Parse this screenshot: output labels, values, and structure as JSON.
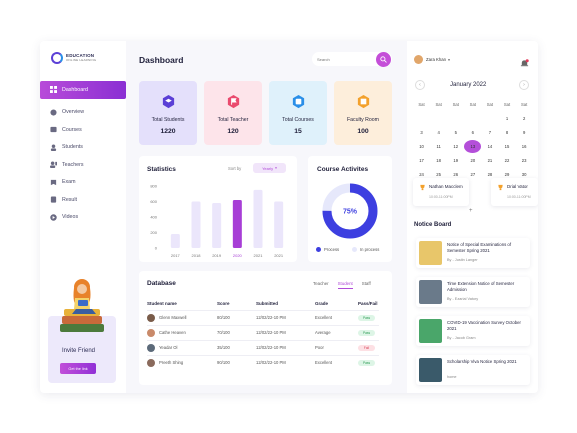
{
  "brand": {
    "name": "EDUCATION",
    "tagline": "ONLINE LEARNING"
  },
  "sidebar": {
    "items": [
      {
        "label": "Dashboard",
        "icon": "grid-icon"
      },
      {
        "label": "Overview",
        "icon": "pie-icon"
      },
      {
        "label": "Courses",
        "icon": "book-icon"
      },
      {
        "label": "Students",
        "icon": "student-icon"
      },
      {
        "label": "Teachers",
        "icon": "teacher-icon"
      },
      {
        "label": "Exam",
        "icon": "exam-icon"
      },
      {
        "label": "Result",
        "icon": "result-icon"
      },
      {
        "label": "Videos",
        "icon": "play-icon"
      }
    ],
    "invite": {
      "title": "Invite Friend",
      "button": "Get the link"
    }
  },
  "header": {
    "title": "Dashboard",
    "search_placeholder": "Search"
  },
  "stats": [
    {
      "label": "Total Students",
      "value": "1220",
      "color": "#e4e0fb",
      "icon_color": "#5b3fd6"
    },
    {
      "label": "Total Teacher",
      "value": "120",
      "color": "#fde4ea",
      "icon_color": "#ea4a6e"
    },
    {
      "label": "Total Courses",
      "value": "15",
      "color": "#dff1fb",
      "icon_color": "#2a8fe8"
    },
    {
      "label": "Faculty Room",
      "value": "100",
      "color": "#fdeedb",
      "icon_color": "#f3a12c"
    }
  ],
  "statistics": {
    "title": "Statistics",
    "sort_label": "Sort by",
    "sort_value": "Yearly"
  },
  "chart_data": {
    "type": "bar",
    "categories": [
      "2017",
      "2018",
      "2019",
      "2020",
      "2021",
      "2021"
    ],
    "values": [
      180,
      600,
      580,
      620,
      750,
      600
    ],
    "highlight_index": 3,
    "yticks": [
      "800",
      "600",
      "400",
      "200",
      "0"
    ],
    "ylim": [
      0,
      800
    ],
    "colors": {
      "bar": "#ebe6fb",
      "highlight": "#a73ed6"
    }
  },
  "course_activity": {
    "title": "Course Activites",
    "percent_label": "75%",
    "percent": 75,
    "legend": [
      "Process",
      "In process"
    ],
    "colors": {
      "process": "#3d3fe0",
      "in_process": "#e6e8fb"
    }
  },
  "database": {
    "title": "Database",
    "tabs": [
      "Teacher",
      "Student",
      "Staff"
    ],
    "active_tab": 1,
    "columns": [
      "Student name",
      "Score",
      "Submitted",
      "Grade",
      "Pass/Fail"
    ],
    "rows": [
      {
        "name": "Glenn Maxwell",
        "score": "80/100",
        "submitted": "12/02/22-10 PM",
        "grade": "Excellent",
        "status": "Pass",
        "avatar": "#7a5c4a"
      },
      {
        "name": "Cathe Heaven",
        "score": "70/100",
        "submitted": "12/02/22-10 PM",
        "grade": "Average",
        "status": "Pass",
        "avatar": "#c98a6a"
      },
      {
        "name": "Yeadar Ol",
        "score": "35/100",
        "submitted": "12/02/22-10 PM",
        "grade": "Poor",
        "status": "Fail",
        "avatar": "#5c6a7a"
      },
      {
        "name": "Preeth Shing",
        "score": "90/100",
        "submitted": "12/02/22-10 PM",
        "grade": "Excellent",
        "status": "Pass",
        "avatar": "#8a6a5c"
      }
    ]
  },
  "user": {
    "name": "Zara Khan"
  },
  "calendar": {
    "title": "January 2022",
    "weekdays": [
      "Sat",
      "Sat",
      "Sat",
      "Sat",
      "Sat",
      "Sat",
      "Sat"
    ],
    "weeks": [
      [
        "",
        "",
        "",
        "",
        "",
        "1",
        "2"
      ],
      [
        "3",
        "4",
        "5",
        "6",
        "7",
        "8",
        "9"
      ],
      [
        "10",
        "11",
        "12",
        "13",
        "14",
        "15",
        "16"
      ],
      [
        "17",
        "18",
        "19",
        "20",
        "21",
        "22",
        "23"
      ],
      [
        "24",
        "25",
        "26",
        "27",
        "28",
        "29",
        "30"
      ]
    ],
    "selected": "13"
  },
  "events": [
    {
      "name": "Nathan Macclem",
      "time": "10:00-11:00PM",
      "icon_color": "#f3a12c"
    },
    {
      "name": "Drial Vator",
      "time": "10:00-11:00PM",
      "icon_color": "#f3a12c"
    }
  ],
  "notice_board": {
    "title": "Notice Board",
    "items": [
      {
        "title": "Notice of Special Examinations of Semester Spring 2021",
        "by": "By - Justin Langer",
        "thumb": "#e8c66a"
      },
      {
        "title": "Time Extension Notice of Semester Admission",
        "by": "By - Ezarial Vatory",
        "thumb": "#6a7a8a"
      },
      {
        "title": "COVID-19 Vaccination Survey October 2021",
        "by": "By - Jacob Gram",
        "thumb": "#4aa66a"
      },
      {
        "title": "Scholarship Viva Notice Spring 2021",
        "by": "home",
        "thumb": "#3a5a6a"
      }
    ]
  }
}
